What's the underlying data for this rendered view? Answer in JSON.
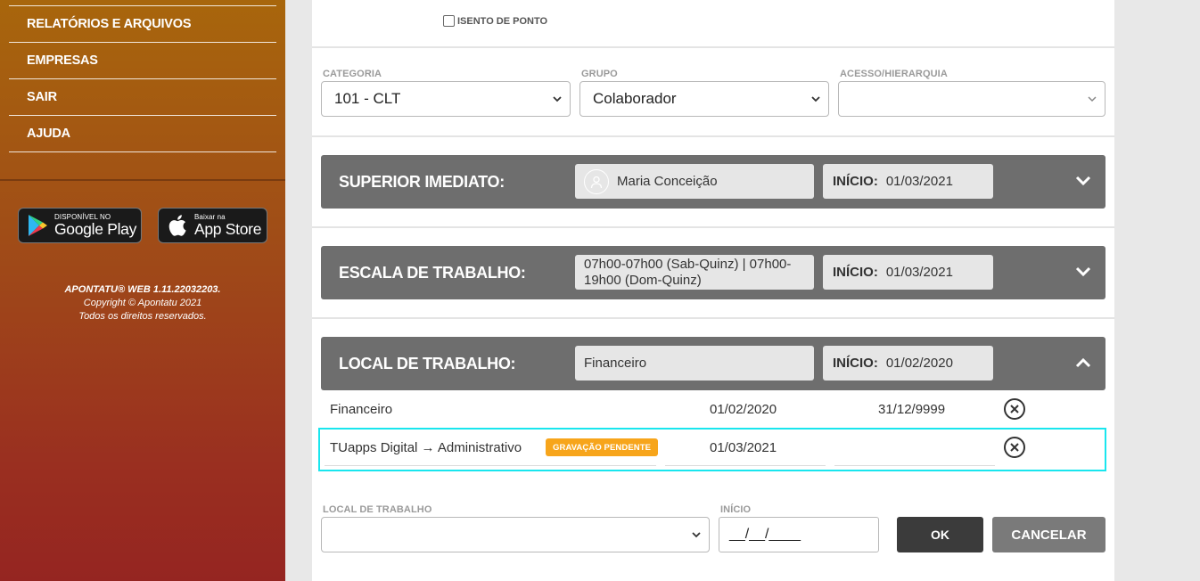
{
  "sidebar": {
    "nav": [
      {
        "label": "RELATÓRIOS E ARQUIVOS"
      },
      {
        "label": "EMPRESAS"
      },
      {
        "label": "SAIR"
      },
      {
        "label": "AJUDA"
      }
    ],
    "google_play": {
      "small": "DISPONÍVEL NO",
      "big": "Google Play",
      "icon": "google-play-icon"
    },
    "app_store": {
      "small": "Baixar na",
      "big": "App Store",
      "icon": "apple-icon"
    },
    "footer": {
      "version": "APONTATU® WEB 1.11.22032203.",
      "copyright": "Copyright © Apontatu 2021",
      "rights": "Todos os direitos reservados."
    }
  },
  "form": {
    "isento_label": "ISENTO DE PONTO",
    "isento_checked": false,
    "categoria": {
      "label": "CATEGORIA",
      "value": "101 - CLT"
    },
    "grupo": {
      "label": "GRUPO",
      "value": "Colaborador"
    },
    "acesso": {
      "label": "ACESSO/HIERARQUIA",
      "value": ""
    }
  },
  "sections": {
    "superior": {
      "title": "SUPERIOR IMEDIATO:",
      "name": "Maria Conceição",
      "inicio_label": "INÍCIO:",
      "inicio": "01/03/2021",
      "toggle": "chevron-down-icon"
    },
    "escala": {
      "title": "ESCALA DE TRABALHO:",
      "name": "07h00-07h00 (Sab-Quinz) | 07h00-19h00 (Dom-Quinz)",
      "inicio_label": "INÍCIO:",
      "inicio": "01/03/2021",
      "toggle": "chevron-down-icon"
    },
    "local": {
      "title": "LOCAL DE TRABALHO:",
      "name": "Financeiro",
      "inicio_label": "INÍCIO:",
      "inicio": "01/02/2020",
      "toggle": "chevron-up-icon"
    }
  },
  "local_rows": [
    {
      "name": "Financeiro",
      "start": "01/02/2020",
      "end": "31/12/9999",
      "pending": false
    },
    {
      "name": "TUapps Digital → Administrativo",
      "start": "01/03/2021",
      "end": "",
      "pending": true,
      "pending_label": "GRAVAÇÃO PENDENTE"
    }
  ],
  "new_entry": {
    "local_label": "LOCAL DE TRABALHO",
    "local_value": "",
    "inicio_label": "INÍCIO",
    "inicio_value": "__/__/____",
    "ok_label": "OK",
    "cancel_label": "CANCELAR"
  },
  "colors": {
    "sidebar_top": "#a8660c",
    "sidebar_bottom": "#952521",
    "section_bar": "#6e6e6e",
    "pending_badge": "#f7a51b",
    "highlight": "#19e6ee"
  }
}
